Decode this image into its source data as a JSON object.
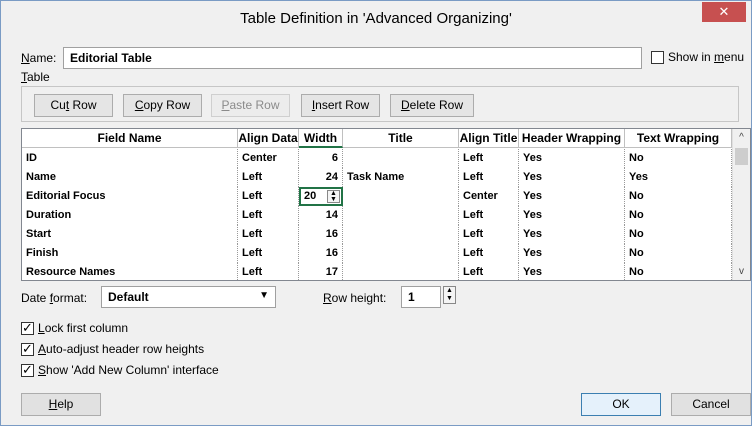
{
  "window": {
    "title": "Table Definition in 'Advanced Organizing'",
    "close_glyph": "✕"
  },
  "name_field": {
    "label": "Name:",
    "value": "Editorial Table"
  },
  "show_in_menu": {
    "label": "Show in menu",
    "checked": false
  },
  "table_label": "Table",
  "toolbar": {
    "cut_row": "Cut Row",
    "copy_row": "Copy Row",
    "paste_row": "Paste Row",
    "insert_row": "Insert Row",
    "delete_row": "Delete Row"
  },
  "grid": {
    "columns": [
      "Field Name",
      "Align Data",
      "Width",
      "Title",
      "Align Title",
      "Header Wrapping",
      "Text Wrapping"
    ],
    "rows": [
      [
        "ID",
        "Center",
        "6",
        "",
        "Left",
        "Yes",
        "No"
      ],
      [
        "Name",
        "Left",
        "24",
        "Task Name",
        "Left",
        "Yes",
        "Yes"
      ],
      [
        "Editorial Focus",
        "Left",
        "20",
        "",
        "Center",
        "Yes",
        "No"
      ],
      [
        "Duration",
        "Left",
        "14",
        "",
        "Left",
        "Yes",
        "No"
      ],
      [
        "Start",
        "Left",
        "16",
        "",
        "Left",
        "Yes",
        "No"
      ],
      [
        "Finish",
        "Left",
        "16",
        "",
        "Left",
        "Yes",
        "No"
      ],
      [
        "Resource Names",
        "Left",
        "17",
        "",
        "Left",
        "Yes",
        "No"
      ]
    ],
    "editing": {
      "row": 2,
      "column": "Width",
      "value": "20"
    }
  },
  "date_format": {
    "label": "Date format:",
    "value": "Default"
  },
  "row_height": {
    "label": "Row height:",
    "value": "1"
  },
  "options": {
    "lock_first_column": {
      "label": "Lock first column",
      "checked": true
    },
    "auto_adjust": {
      "label": "Auto-adjust header row heights",
      "checked": true
    },
    "show_add_column": {
      "label": "Show 'Add New Column' interface",
      "checked": true
    }
  },
  "buttons": {
    "help": "Help",
    "ok": "OK",
    "cancel": "Cancel"
  },
  "colors": {
    "accent": "#217346",
    "close": "#c75050",
    "ok_border": "#3c7fb1"
  },
  "icons": [
    "close-icon",
    "scroll-up-icon",
    "scroll-down-icon",
    "dropdown-arrow-icon",
    "spin-icon"
  ]
}
